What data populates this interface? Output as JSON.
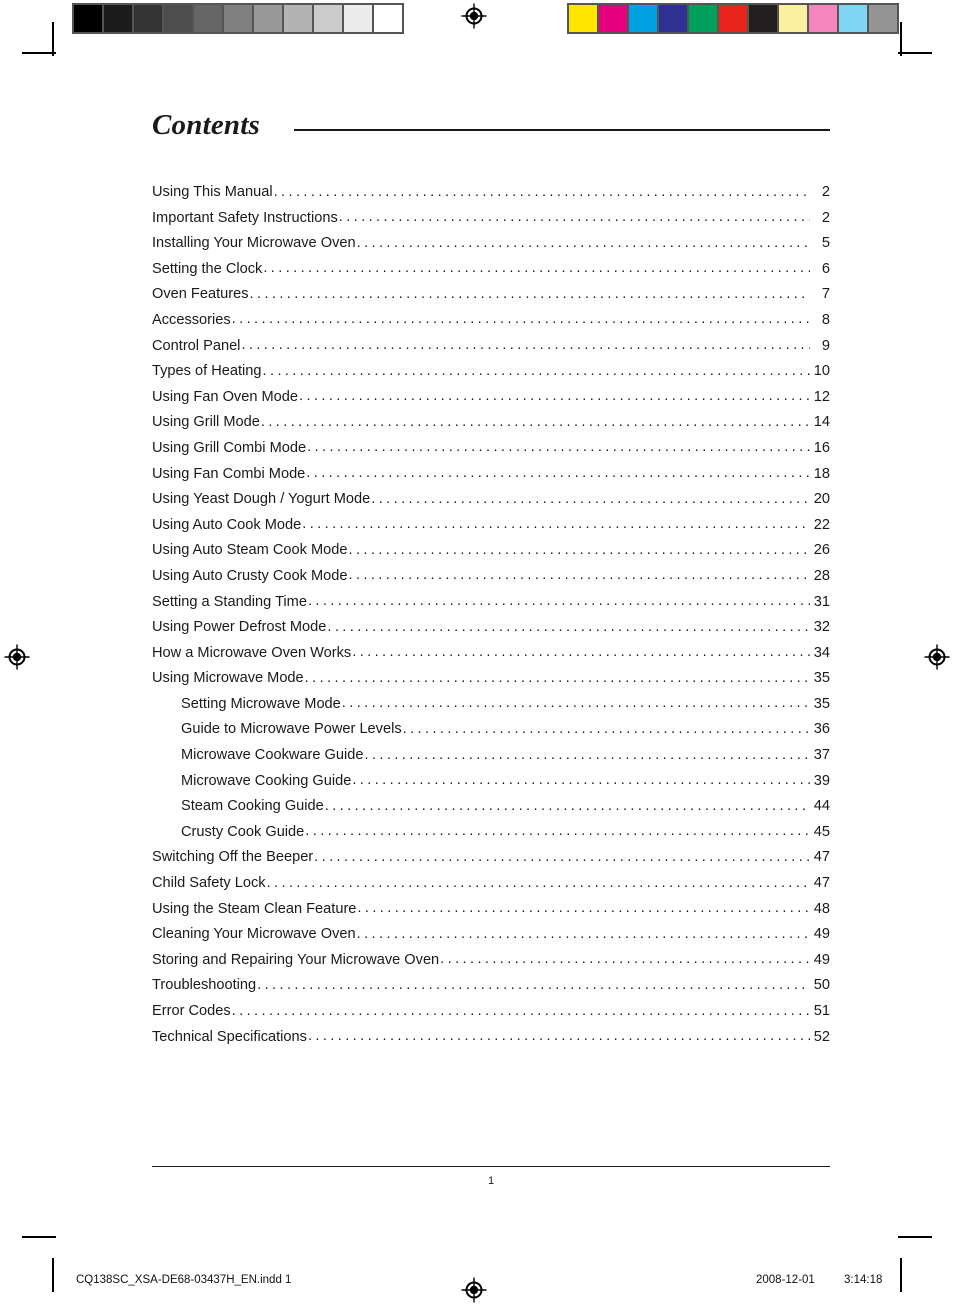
{
  "document": {
    "title": "Contents",
    "folio": "1"
  },
  "toc": {
    "entries": [
      {
        "label": "Using This Manual",
        "page": "2",
        "level": 0
      },
      {
        "label": "Important Safety Instructions",
        "page": "2",
        "level": 0
      },
      {
        "label": "Installing Your Microwave Oven",
        "page": "5",
        "level": 0
      },
      {
        "label": "Setting the Clock",
        "page": "6",
        "level": 0
      },
      {
        "label": "Oven Features",
        "page": "7",
        "level": 0
      },
      {
        "label": "Accessories",
        "page": "8",
        "level": 0
      },
      {
        "label": "Control Panel",
        "page": "9",
        "level": 0
      },
      {
        "label": "Types of Heating",
        "page": "10",
        "level": 0
      },
      {
        "label": "Using Fan Oven Mode",
        "page": "12",
        "level": 0
      },
      {
        "label": "Using Grill Mode",
        "page": "14",
        "level": 0
      },
      {
        "label": "Using Grill Combi Mode",
        "page": "16",
        "level": 0
      },
      {
        "label": "Using Fan Combi Mode",
        "page": "18",
        "level": 0
      },
      {
        "label": "Using Yeast Dough / Yogurt Mode",
        "page": "20",
        "level": 0
      },
      {
        "label": "Using Auto Cook Mode",
        "page": "22",
        "level": 0
      },
      {
        "label": "Using Auto Steam Cook Mode",
        "page": "26",
        "level": 0
      },
      {
        "label": "Using Auto Crusty Cook Mode",
        "page": "28",
        "level": 0
      },
      {
        "label": "Setting a Standing Time",
        "page": "31",
        "level": 0
      },
      {
        "label": "Using Power Defrost Mode",
        "page": "32",
        "level": 0
      },
      {
        "label": "How a Microwave Oven Works",
        "page": "34",
        "level": 0
      },
      {
        "label": "Using Microwave Mode",
        "page": "35",
        "level": 0
      },
      {
        "label": "Setting Microwave Mode",
        "page": "35",
        "level": 1
      },
      {
        "label": "Guide to Microwave Power Levels",
        "page": "36",
        "level": 1
      },
      {
        "label": "Microwave Cookware Guide",
        "page": "37",
        "level": 1
      },
      {
        "label": "Microwave Cooking Guide",
        "page": "39",
        "level": 1
      },
      {
        "label": "Steam Cooking Guide",
        "page": "44",
        "level": 1
      },
      {
        "label": "Crusty Cook Guide",
        "page": "45",
        "level": 1
      },
      {
        "label": "Switching Off the Beeper",
        "page": "47",
        "level": 0
      },
      {
        "label": "Child Safety Lock",
        "page": "47",
        "level": 0
      },
      {
        "label": "Using the Steam Clean Feature",
        "page": "48",
        "level": 0
      },
      {
        "label": "Cleaning Your Microwave Oven",
        "page": "49",
        "level": 0
      },
      {
        "label": "Storing and Repairing Your Microwave Oven",
        "page": "49",
        "level": 0
      },
      {
        "label": "Troubleshooting",
        "page": "50",
        "level": 0
      },
      {
        "label": "Error Codes",
        "page": "51",
        "level": 0
      },
      {
        "label": "Technical Specifications",
        "page": "52",
        "level": 0
      }
    ]
  },
  "slug": {
    "filename": "CQ138SC_XSA-DE68-03437H_EN.indd   1",
    "date": "2008-12-01",
    "time": "3:14:18"
  },
  "print_marks": {
    "grayscale_swatches": [
      "#000000",
      "#1c1c1c",
      "#333333",
      "#4d4d4d",
      "#666666",
      "#808080",
      "#999999",
      "#b3b3b3",
      "#cccccc",
      "#ececec",
      "#ffffff"
    ],
    "color_swatches": [
      "#ffe600",
      "#e6007e",
      "#00a0e3",
      "#2e3192",
      "#00a05a",
      "#e8241c",
      "#231f20",
      "#fcf0a0",
      "#f586bd",
      "#82d6f5",
      "#949494"
    ],
    "registration_icon": "registration-target-icon"
  }
}
